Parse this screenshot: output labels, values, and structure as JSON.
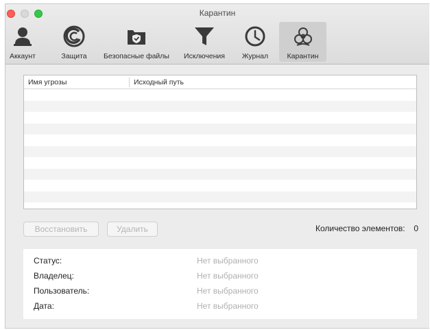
{
  "window": {
    "title": "Карантин"
  },
  "toolbar": {
    "items": [
      {
        "label": "Аккаунт",
        "icon": "account-icon",
        "active": false
      },
      {
        "label": "Защита",
        "icon": "protection-icon",
        "active": false
      },
      {
        "label": "Безопасные файлы",
        "icon": "safe-files-icon",
        "active": false
      },
      {
        "label": "Исключения",
        "icon": "exclusions-filter-icon",
        "active": false
      },
      {
        "label": "Журнал",
        "icon": "log-clock-icon",
        "active": false
      },
      {
        "label": "Карантин",
        "icon": "biohazard-icon",
        "active": true
      }
    ]
  },
  "table": {
    "columns": [
      "Имя угрозы",
      "Исходный путь"
    ],
    "rows": []
  },
  "actions": {
    "restore_label": "Восстановить",
    "delete_label": "Удалить"
  },
  "count": {
    "label": "Количество элементов:",
    "value": "0"
  },
  "details": {
    "fields": [
      {
        "key": "Статус:",
        "value": "Нет выбранного"
      },
      {
        "key": "Владелец:",
        "value": "Нет выбранного"
      },
      {
        "key": "Пользователь:",
        "value": "Нет выбранного"
      },
      {
        "key": "Дата:",
        "value": "Нет выбранного"
      }
    ]
  },
  "colors": {
    "close": "#fc5f57",
    "minimize": "#d9d9d9",
    "zoom": "#34c84a",
    "icon": "#3a3a3a"
  }
}
